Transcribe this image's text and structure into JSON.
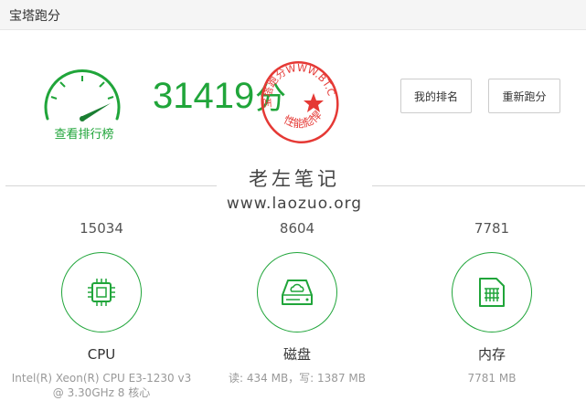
{
  "window": {
    "title": "宝塔跑分"
  },
  "score": {
    "total": "31419",
    "unit": "分",
    "rank_link": "查看排行榜"
  },
  "stamp": {
    "top_text": "宝塔跑分WWW.BT.CN",
    "bottom_text": "性能彪悍",
    "color": "#e53935"
  },
  "buttons": {
    "my_rank": "我的排名",
    "retest": "重新跑分"
  },
  "watermark": {
    "title": "老左笔记",
    "url": "www.laozuo.org"
  },
  "metrics": {
    "cpu": {
      "score": "15034",
      "label": "CPU",
      "detail": "Intel(R) Xeon(R) CPU E3-1230 v3 @ 3.30GHz 8 核心",
      "icon": "cpu-chip-icon"
    },
    "disk": {
      "score": "8604",
      "label": "磁盘",
      "detail": "读: 434 MB，写: 1387 MB",
      "icon": "cloud-disk-icon"
    },
    "memory": {
      "score": "7781",
      "label": "内存",
      "detail": "7781 MB",
      "icon": "memory-card-icon"
    }
  },
  "colors": {
    "accent": "#20a53a",
    "stamp": "#e53935"
  }
}
